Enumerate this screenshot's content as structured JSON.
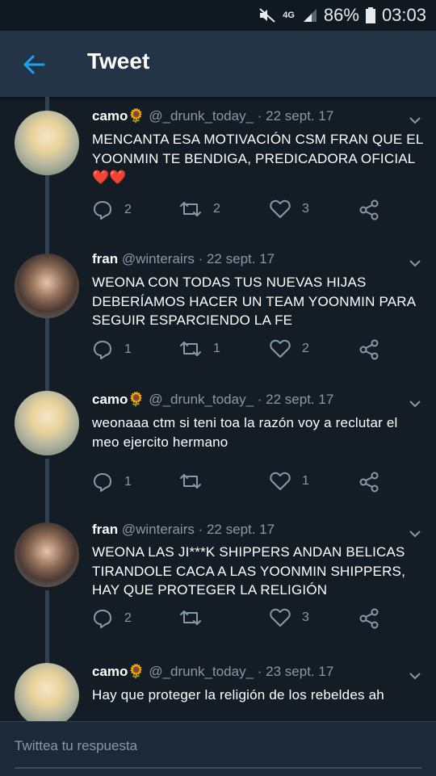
{
  "status": {
    "network": "4G",
    "battery": "86%",
    "time": "03:03"
  },
  "header": {
    "title": "Tweet"
  },
  "tweets": [
    {
      "name": "camo🌻",
      "handle": "@_drunk_today_",
      "date": "· 22 sept. 17",
      "text": "MENCANTA ESA MOTIVACIÓN CSM FRAN QUE EL YOONMIN TE BENDIGA, PREDICADORA OFICIAL❤️❤️",
      "replies": "2",
      "retweets": "2",
      "likes": "3"
    },
    {
      "name": "fran",
      "handle": "@winterairs",
      "date": "· 22 sept. 17",
      "text": "WEONA CON TODAS TUS NUEVAS HIJAS DEBERÍAMOS HACER UN TEAM YOONMIN PARA SEGUIR ESPARCIENDO LA FE",
      "replies": "1",
      "retweets": "1",
      "likes": "2"
    },
    {
      "name": "camo🌻",
      "handle": "@_drunk_today_",
      "date": "· 22 sept. 17",
      "text": "weonaaa ctm si teni toa la razón voy a reclutar el meo ejercito hermano",
      "replies": "1",
      "retweets": "",
      "likes": "1"
    },
    {
      "name": "fran",
      "handle": "@winterairs",
      "date": "· 22 sept. 17",
      "text": "WEONA LAS JI***K SHIPPERS ANDAN BELICAS TIRANDOLE CACA A LAS YOONMIN SHIPPERS, HAY QUE PROTEGER LA RELIGIÓN",
      "replies": "2",
      "retweets": "",
      "likes": "3"
    },
    {
      "name": "camo🌻",
      "handle": "@_drunk_today_",
      "date": "· 23 sept. 17",
      "text": "Hay que proteger la religión de los rebeldes ah"
    }
  ],
  "reply": {
    "placeholder": "Twittea tu respuesta"
  },
  "colors": {
    "background": "#141d26",
    "header": "#243447",
    "accent": "#1da1f2",
    "muted": "#8899a6"
  },
  "icons": [
    "mute-icon",
    "signal-icon",
    "battery-icon",
    "back-arrow-icon",
    "chevron-down-icon",
    "reply-icon",
    "retweet-icon",
    "like-icon",
    "share-icon"
  ]
}
